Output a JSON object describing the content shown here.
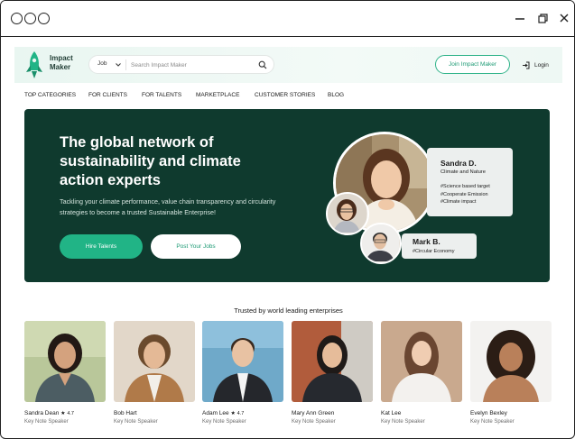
{
  "brand": {
    "name": "Impact Maker",
    "accent": "#21b486",
    "dark": "#0f3a2e"
  },
  "search": {
    "category": "Job",
    "placeholder": "Search Impact Maker"
  },
  "header": {
    "join_label": "Join Impact Maker",
    "login_label": "Login"
  },
  "nav": [
    "TOP CATEGORIES",
    "FOR CLIENTS",
    "FOR TALENTS",
    "MARKETPLACE",
    "CUSTOMER STORIES",
    "BLOG"
  ],
  "hero": {
    "title": "The global network of sustainability and climate action experts",
    "subtitle": "Tackling your climate performance, value chain transparency and circularity strategies to become a trusted Sustainable Enterprise!",
    "primary_button": "Hire Talents",
    "secondary_button": "Post Your Jobs",
    "featured": {
      "name": "Sandra D.",
      "role": "Climate and Nature",
      "tags": [
        "#Science based target",
        "#Cooperate Emission",
        "#Climate impact"
      ]
    },
    "secondary": {
      "name": "Mark B.",
      "tag": "#Circular Economy"
    }
  },
  "trusted_heading": "Trusted by world leading enterprises",
  "speakers": [
    {
      "name": "Sandra Dean",
      "rating": "4.7",
      "role": "Key Note Speaker"
    },
    {
      "name": "Bob Hart",
      "rating": "",
      "role": "Key Note Speaker"
    },
    {
      "name": "Adam Lee",
      "rating": "4.7",
      "role": "Key Note Speaker"
    },
    {
      "name": "Mary Ann Green",
      "rating": "",
      "role": "Key Note Speaker"
    },
    {
      "name": "Kat Lee",
      "rating": "",
      "role": "Key Note Speaker"
    },
    {
      "name": "Evelyn Bexley",
      "rating": "",
      "role": "Key Note Speaker"
    }
  ]
}
